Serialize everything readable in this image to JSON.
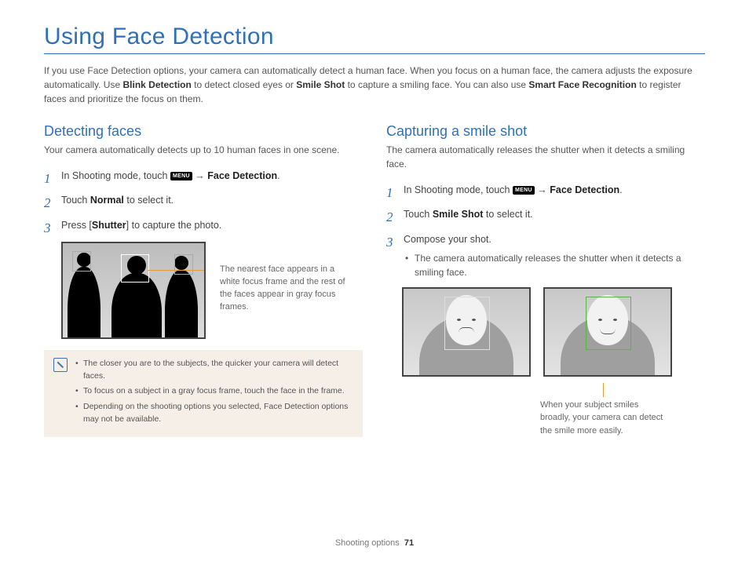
{
  "title": "Using Face Detection",
  "intro": {
    "part1": "If you use Face Detection options, your camera can automatically detect a human face. When you focus on a human face, the camera adjusts the exposure automatically. Use ",
    "bold1": "Blink Detection",
    "part2": " to detect closed eyes or ",
    "bold2": "Smile Shot",
    "part3": " to capture a smiling face. You can also use ",
    "bold3": "Smart Face Recognition",
    "part4": " to register faces and prioritize the focus on them."
  },
  "left": {
    "heading": "Detecting faces",
    "lead": "Your camera automatically detects up to 10 human faces in one scene.",
    "step1_a": "In Shooting mode, touch ",
    "step1_menu": "MENU",
    "step1_arrow": " → ",
    "step1_b": "Face Detection",
    "step1_c": ".",
    "step2_a": "Touch ",
    "step2_b": "Normal",
    "step2_c": " to select it.",
    "step3_a": "Press [",
    "step3_b": "Shutter",
    "step3_c": "] to capture the photo.",
    "caption": "The nearest face appears in a white focus frame and the rest of the faces appear in gray focus frames.",
    "note1": "The closer you are to the subjects, the quicker your camera will detect faces.",
    "note2": "To focus on a subject in a gray focus frame, touch the face in the frame.",
    "note3": "Depending on the shooting options you selected, Face Detection options may not be available."
  },
  "right": {
    "heading": "Capturing a smile shot",
    "lead": "The camera automatically releases the shutter when it detects a smiling face.",
    "step1_a": "In Shooting mode, touch ",
    "step1_menu": "MENU",
    "step1_arrow": " → ",
    "step1_b": "Face Detection",
    "step1_c": ".",
    "step2_a": "Touch ",
    "step2_b": "Smile Shot",
    "step2_c": " to select it.",
    "step3": "Compose your shot.",
    "step3_sub": "The camera automatically releases the shutter when it detects a smiling face.",
    "caption": "When your subject smiles broadly, your camera can detect the smile more easily."
  },
  "footer": {
    "section": "Shooting options",
    "page": "71"
  }
}
